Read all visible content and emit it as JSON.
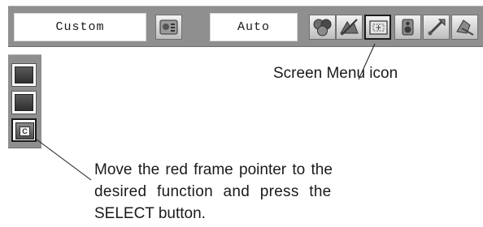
{
  "menubar": {
    "fields": {
      "mode_value": "Custom",
      "setting_value": "Auto"
    },
    "icons": [
      {
        "name": "image-adjust-icon",
        "selected": false
      },
      {
        "name": "color-adjust-icon",
        "selected": false
      },
      {
        "name": "image-select-icon",
        "selected": false
      },
      {
        "name": "screen-menu-icon",
        "selected": true
      },
      {
        "name": "sound-icon",
        "selected": false
      },
      {
        "name": "setting-icon",
        "selected": false
      },
      {
        "name": "extended-icon",
        "selected": false
      }
    ]
  },
  "submenu": {
    "items": [
      {
        "name": "screen-option-icon",
        "selected": false
      },
      {
        "name": "screen-option-icon",
        "selected": false
      },
      {
        "name": "custom-screen-icon",
        "selected": true,
        "glyph": "C"
      }
    ]
  },
  "annotations": {
    "screen_menu_label": "Screen Menu icon",
    "instruction_line1": "Move the red frame pointer to the",
    "instruction_line2": "desired function and press the",
    "instruction_line3": "SELECT button."
  },
  "colors": {
    "bar": "#8f8f8f",
    "field": "#ffffff",
    "text": "#1a1a1a"
  }
}
